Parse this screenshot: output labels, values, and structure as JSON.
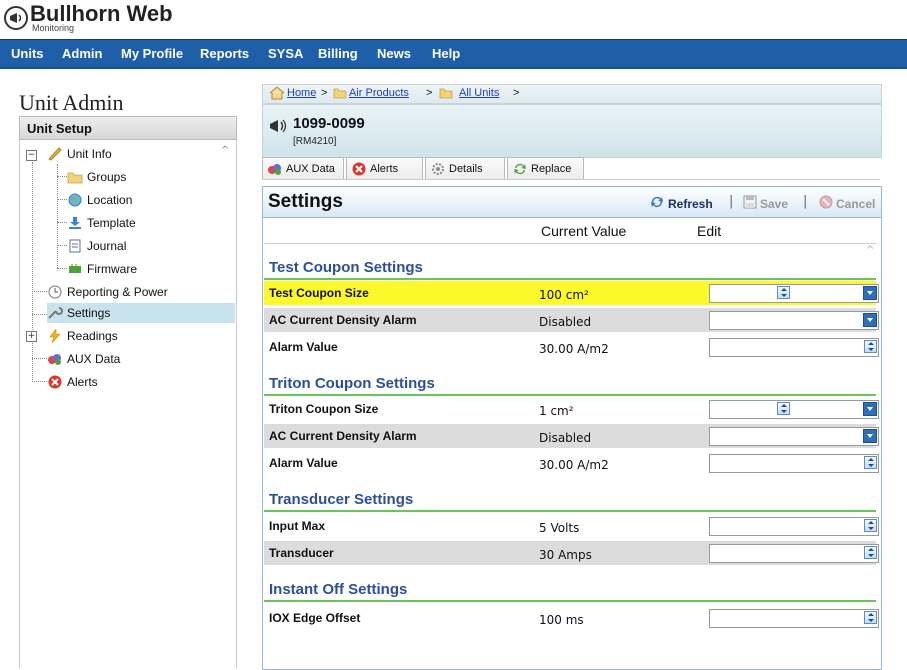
{
  "brand": {
    "name": "Bullhorn Web",
    "sub": "Monitoring"
  },
  "nav": [
    "Units",
    "Admin",
    "My Profile",
    "Reports",
    "SYSA",
    "Billing",
    "News",
    "Help"
  ],
  "sidebar": {
    "title": "Unit Admin",
    "section": "Unit Setup",
    "items": [
      {
        "label": "Unit Info",
        "icon": "pencil-icon"
      },
      {
        "label": "Groups",
        "icon": "folder-icon"
      },
      {
        "label": "Location",
        "icon": "globe-icon"
      },
      {
        "label": "Template",
        "icon": "download-arrow-icon"
      },
      {
        "label": "Journal",
        "icon": "document-icon"
      },
      {
        "label": "Firmware",
        "icon": "chip-icon"
      },
      {
        "label": "Reporting & Power",
        "icon": "clock-icon"
      },
      {
        "label": "Settings",
        "icon": "wrench-icon"
      },
      {
        "label": "Readings",
        "icon": "lightning-icon"
      },
      {
        "label": "AUX Data",
        "icon": "aux-icon"
      },
      {
        "label": "Alerts",
        "icon": "alert-x-icon"
      }
    ]
  },
  "breadcrumb": {
    "home": "Home",
    "sep": ">",
    "items": [
      "Air Products",
      "All Units"
    ]
  },
  "unit": {
    "id": "1099-0099",
    "model": "[RM4210]"
  },
  "tabs": [
    "AUX Data",
    "Alerts",
    "Details",
    "Replace"
  ],
  "settings": {
    "title": "Settings",
    "refresh": "Refresh",
    "save": "Save",
    "cancel": "Cancel",
    "separator": "|",
    "col_current": "Current Value",
    "col_edit": "Edit",
    "sections": [
      {
        "title": "Test Coupon Settings",
        "rows": [
          {
            "label": "Test Coupon Size",
            "value": "100 cm²",
            "control": "spin-combo"
          },
          {
            "label": "AC Current Density Alarm",
            "value": "Disabled",
            "control": "dropdown"
          },
          {
            "label": "Alarm Value",
            "value": "30.00 A/m2",
            "control": "spin"
          }
        ]
      },
      {
        "title": "Triton Coupon Settings",
        "rows": [
          {
            "label": "Triton Coupon Size",
            "value": "1 cm²",
            "control": "spin-combo"
          },
          {
            "label": "AC Current Density Alarm",
            "value": "Disabled",
            "control": "dropdown"
          },
          {
            "label": "Alarm Value",
            "value": "30.00 A/m2",
            "control": "spin"
          }
        ]
      },
      {
        "title": "Transducer Settings",
        "rows": [
          {
            "label": "Input Max",
            "value": "5 Volts",
            "control": "spin"
          },
          {
            "label": "Transducer",
            "value": "30 Amps",
            "control": "spin"
          }
        ]
      },
      {
        "title": "Instant Off Settings",
        "rows": [
          {
            "label": "IOX Edge Offset",
            "value": "100 ms",
            "control": "spin"
          }
        ]
      }
    ]
  },
  "colors": {
    "nav": "#1f5fa8",
    "section_title": "#2d4f9a",
    "section_rule": "#6cc55a",
    "highlight": "#fbf92a"
  }
}
